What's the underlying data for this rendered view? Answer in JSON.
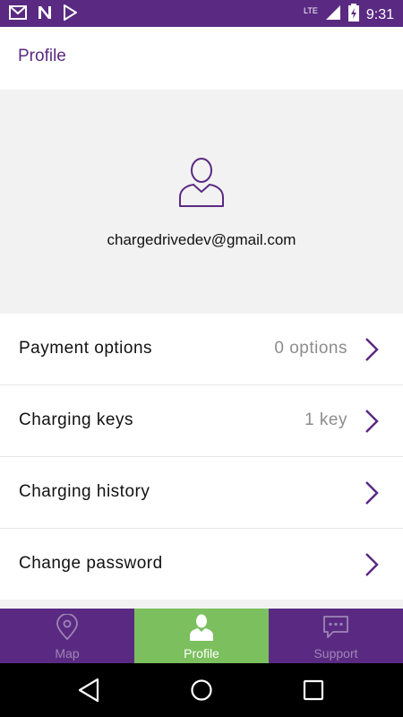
{
  "status_bar": {
    "time": "9:31",
    "network_label": "LTE",
    "icons": [
      "gmail-icon",
      "n-app-icon",
      "play-store-icon",
      "signal-icon",
      "battery-charging-icon"
    ]
  },
  "app_bar": {
    "title": "Profile"
  },
  "profile": {
    "email": "chargedrivedev@gmail.com",
    "avatar_icon": "user-icon"
  },
  "menu": {
    "items": [
      {
        "label": "Payment options",
        "value": "0 options"
      },
      {
        "label": "Charging keys",
        "value": "1 key"
      },
      {
        "label": "Charging history",
        "value": ""
      },
      {
        "label": "Change password",
        "value": ""
      }
    ]
  },
  "bottom_nav": {
    "tabs": [
      {
        "label": "Map",
        "icon": "location-pin-icon",
        "active": false
      },
      {
        "label": "Profile",
        "icon": "user-icon",
        "active": true
      },
      {
        "label": "Support",
        "icon": "chat-bubble-icon",
        "active": false
      }
    ]
  },
  "colors": {
    "primary": "#5a2a82",
    "active_tab": "#7cbf5e",
    "muted_text": "#8c8c8c"
  }
}
